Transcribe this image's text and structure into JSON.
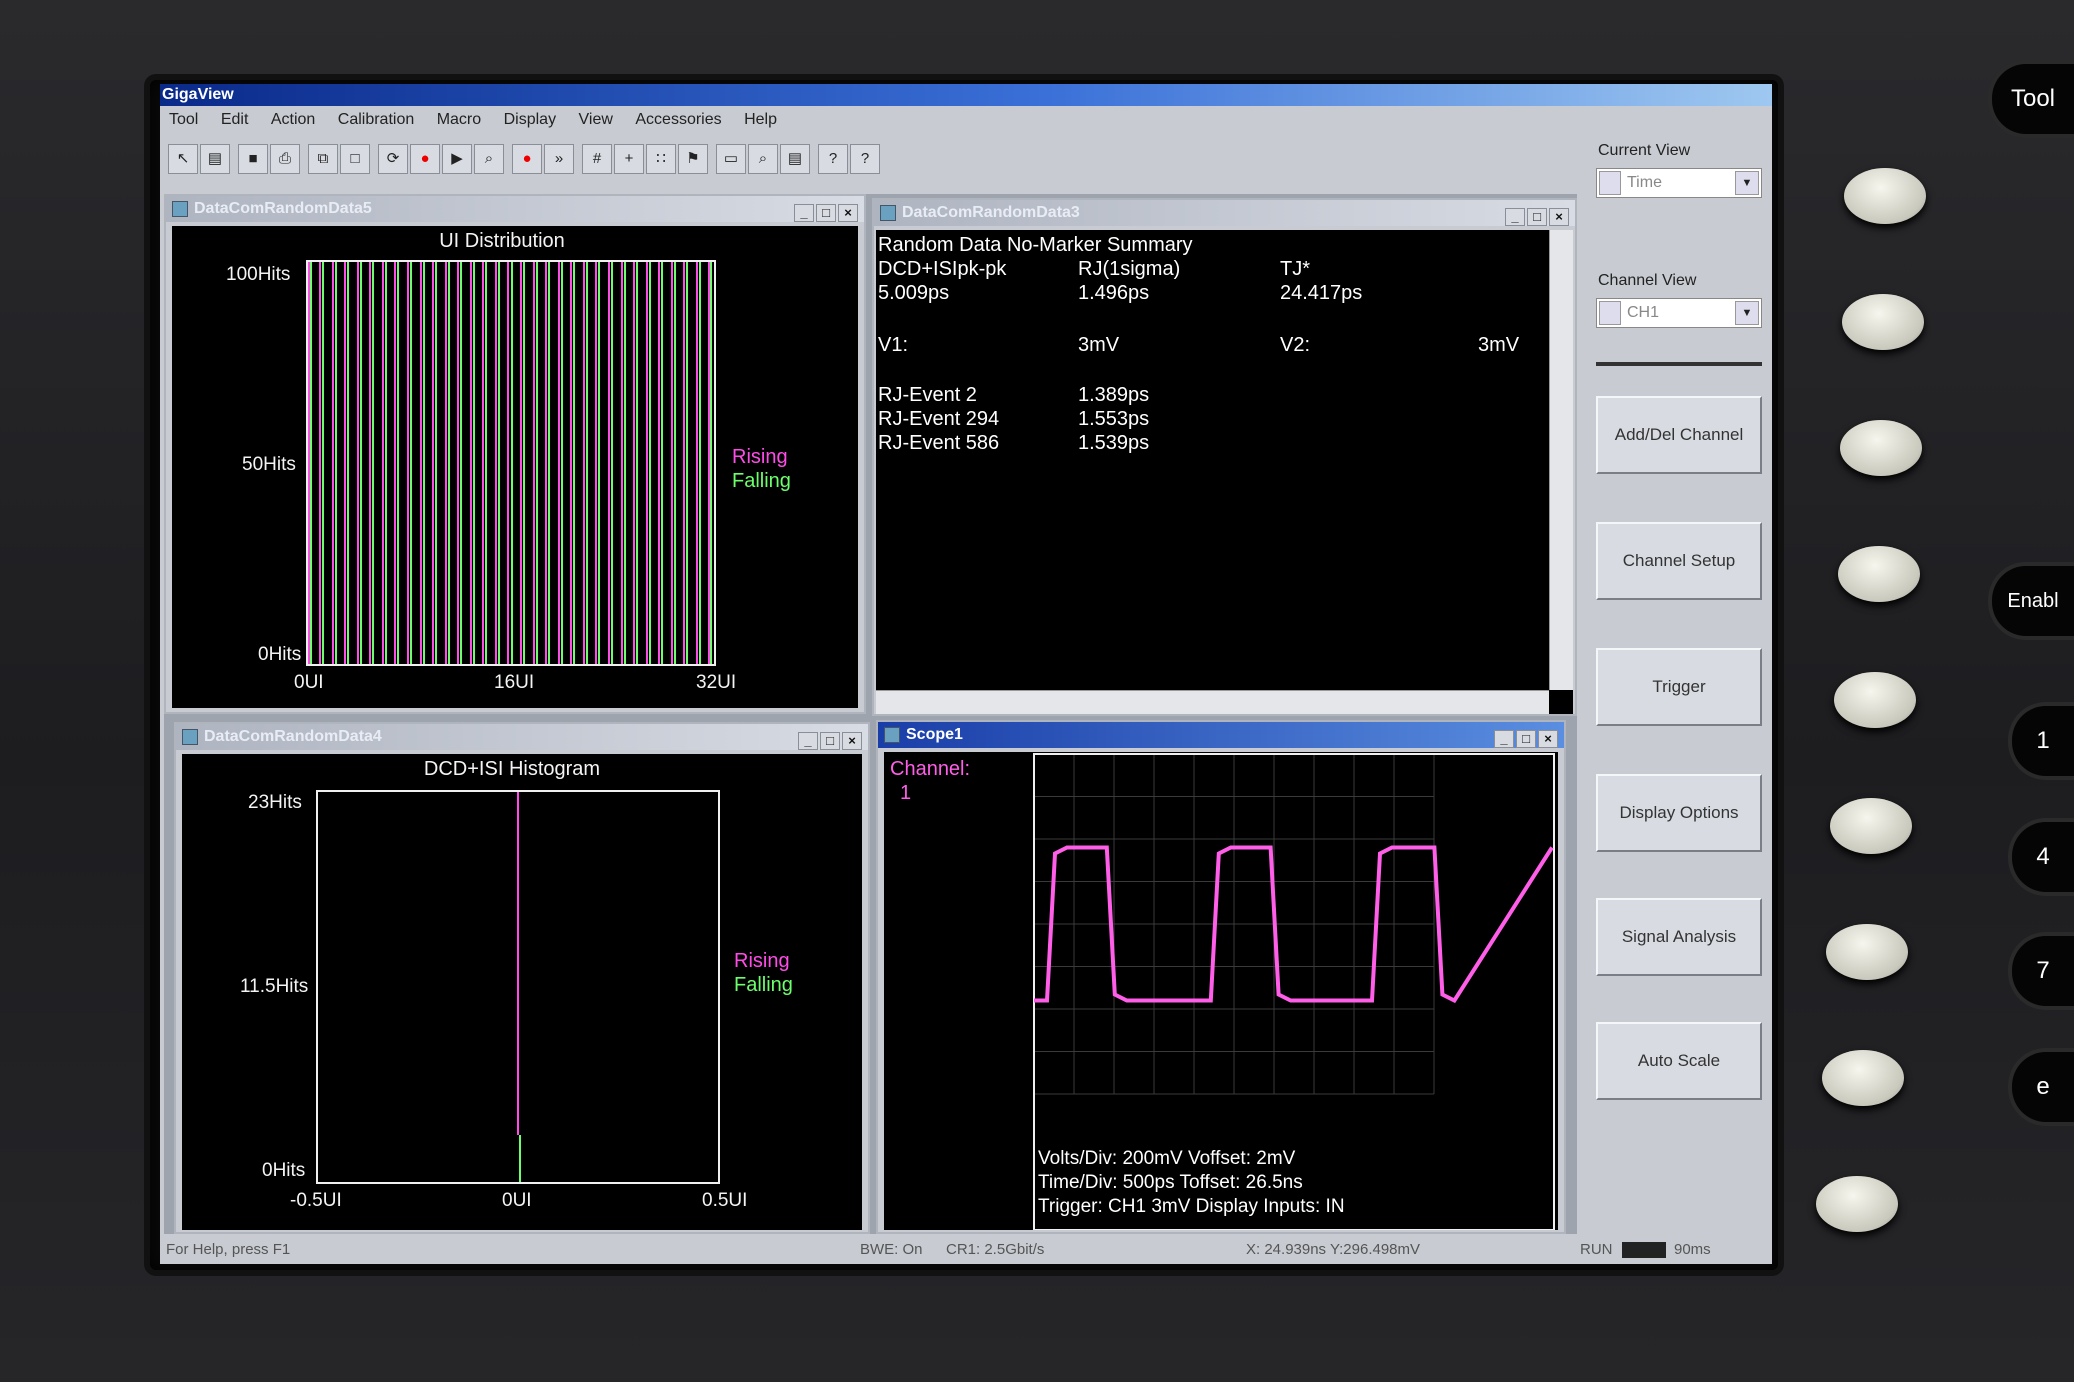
{
  "app": {
    "title": "GigaView"
  },
  "menu": [
    "Tool",
    "Edit",
    "Action",
    "Calibration",
    "Macro",
    "Display",
    "View",
    "Accessories",
    "Help"
  ],
  "toolbar_icons": [
    "cursor-icon",
    "open-icon",
    "save-icon",
    "print-icon",
    "copy-icon",
    "blank-icon",
    "cycle-icon",
    "stop-icon",
    "step-icon",
    "zoom-icon",
    "record-icon",
    "run-fast-icon",
    "grid-icon",
    "cross-icon",
    "dots-icon",
    "marker-icon",
    "monitor-icon",
    "search-icon",
    "doc-icon",
    "help-icon",
    "context-help-icon"
  ],
  "window_controls": {
    "minimize": "_",
    "maximize": "□",
    "close": "×"
  },
  "win_ui": {
    "title": "DataComRandomData5",
    "chart_title": "UI Distribution",
    "y_ticks": [
      "100Hits",
      "50Hits",
      "0Hits"
    ],
    "x_ticks": [
      "0UI",
      "16UI",
      "32UI"
    ],
    "legend": {
      "rising": "Rising",
      "falling": "Falling"
    }
  },
  "win_summary": {
    "title": "DataComRandomData3",
    "heading": "Random Data No-Marker Summary",
    "col1_label": "DCD+ISIpk-pk",
    "col1_value": "5.009ps",
    "col2_label": "RJ(1sigma)",
    "col2_value": "1.496ps",
    "col3_label": "TJ*",
    "col3_value": "24.417ps",
    "v1_label": "V1:",
    "v1_value": "3mV",
    "v2_label": "V2:",
    "v2_value": "3mV",
    "events": [
      {
        "label": "RJ-Event 2",
        "value": "1.389ps"
      },
      {
        "label": "RJ-Event 294",
        "value": "1.553ps"
      },
      {
        "label": "RJ-Event 586",
        "value": "1.539ps"
      }
    ]
  },
  "win_hist": {
    "title": "DataComRandomData4",
    "chart_title": "DCD+ISI Histogram",
    "y_ticks": [
      "23Hits",
      "11.5Hits",
      "0Hits"
    ],
    "x_ticks": [
      "-0.5UI",
      "0UI",
      "0.5UI"
    ],
    "legend": {
      "rising": "Rising",
      "falling": "Falling"
    }
  },
  "win_scope": {
    "title": "Scope1",
    "channel_label": "Channel:",
    "channel_value": "1",
    "info1": "Volts/Div: 200mV Voffset: 2mV",
    "info2": "Time/Div: 500ps Toffset: 26.5ns",
    "info3": "Trigger: CH1 3mV Display Inputs: IN"
  },
  "chart_data": [
    {
      "type": "bar",
      "title": "UI Distribution",
      "x_range_ui": [
        0,
        32
      ],
      "ylim_hits": [
        0,
        100
      ],
      "series": [
        {
          "name": "Rising",
          "color": "#ff4ce8"
        },
        {
          "name": "Falling",
          "color": "#6cff6c"
        }
      ]
    },
    {
      "type": "bar",
      "title": "DCD+ISI Histogram",
      "x_range_ui": [
        -0.5,
        0.5
      ],
      "ylim_hits": [
        0,
        23
      ],
      "series": [
        {
          "name": "Rising",
          "color": "#ff4ce8"
        },
        {
          "name": "Falling",
          "color": "#6cff6c"
        }
      ]
    },
    {
      "type": "line",
      "title": "",
      "color": "#ff5ee8",
      "x_divisions": 10,
      "y_divisions": 8,
      "levels_div": {
        "high": 1.8,
        "low": -1.8
      },
      "transitions_div": [
        {
          "rise": 0.25,
          "fall": 1.4
        },
        {
          "rise": 3.4,
          "fall": 4.55
        },
        {
          "rise": 6.5,
          "fall": 7.7
        }
      ]
    }
  ],
  "right_panel": {
    "current_view_label": "Current View",
    "current_view_value": "Time",
    "channel_view_label": "Channel View",
    "channel_view_value": "CH1",
    "buttons": [
      "Add/Del Channel",
      "Channel Setup",
      "Trigger",
      "Display Options",
      "Signal Analysis",
      "Auto Scale"
    ]
  },
  "status": {
    "help": "For Help, press F1",
    "bwe": "BWE: On",
    "cr": "CR1: 2.5Gbit/s",
    "coords": "X: 24.939ns Y:296.498mV",
    "run": "RUN",
    "time": "90ms"
  },
  "hardware": {
    "labels": [
      "Tool",
      "Enabl",
      "1",
      "4",
      "7",
      "e"
    ]
  },
  "colors": {
    "rising": "#ff4ce8",
    "falling": "#6cff6c",
    "title_active": "#1a3ea8"
  }
}
